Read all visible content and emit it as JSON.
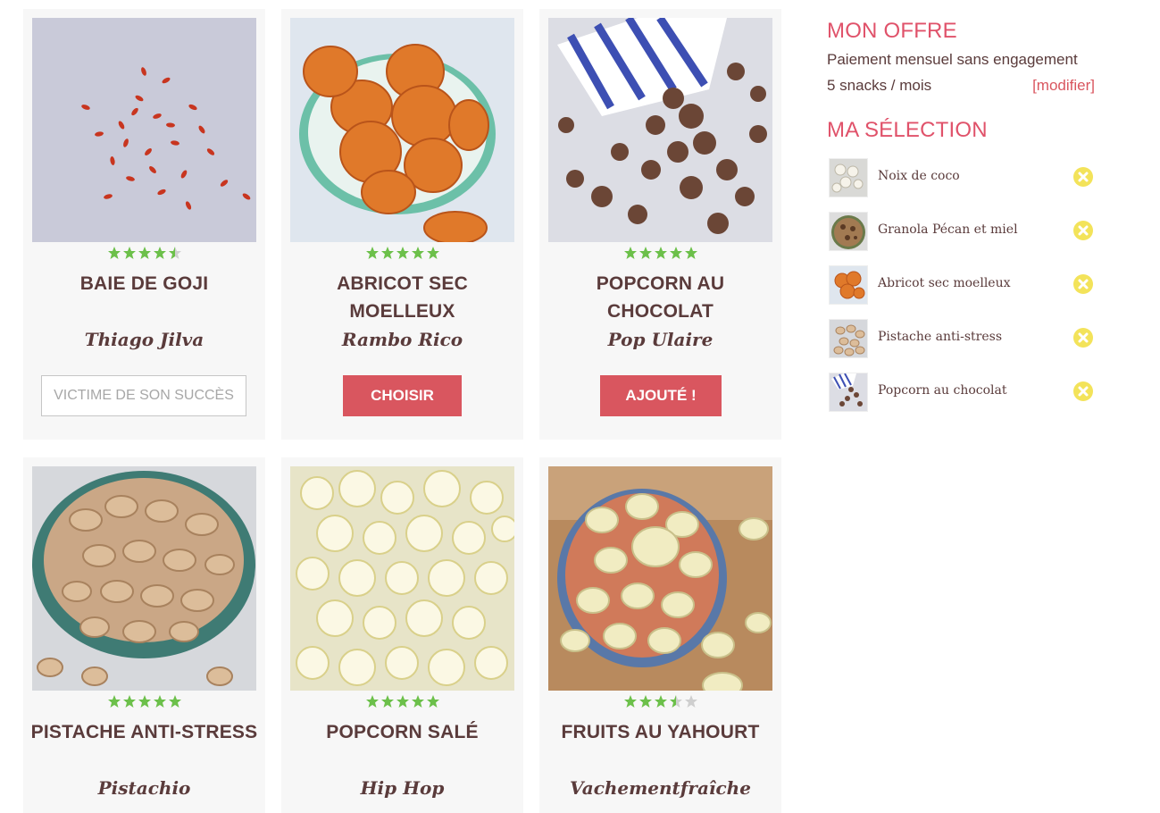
{
  "products": [
    {
      "name": "BAIE DE GOJI",
      "brand": "Thiago Jilva",
      "rating": 4.5,
      "button": "VICTIME DE SON SUCCÈS",
      "button_style": "outline",
      "image_icon": "goji-berries-image"
    },
    {
      "name": "ABRICOT SEC MOELLEUX",
      "brand": "Rambo Rico",
      "rating": 5,
      "button": "CHOISIR",
      "button_style": "red",
      "image_icon": "dried-apricot-image"
    },
    {
      "name": "POPCORN AU CHOCOLAT",
      "brand": "Pop Ulaire",
      "rating": 5,
      "button": "AJOUTÉ !",
      "button_style": "red",
      "image_icon": "chocolate-popcorn-image"
    },
    {
      "name": "PISTACHE ANTI-STRESS",
      "brand": "Pistachio",
      "rating": 5,
      "button": "",
      "button_style": "none",
      "image_icon": "pistachio-image"
    },
    {
      "name": "POPCORN SALÉ",
      "brand": "Hip Hop",
      "rating": 5,
      "button": "",
      "button_style": "none",
      "image_icon": "salted-popcorn-image"
    },
    {
      "name": "FRUITS AU YAHOURT",
      "brand": "Vachementfraîche",
      "rating": 3.5,
      "button": "",
      "button_style": "none",
      "image_icon": "yogurt-fruits-image"
    }
  ],
  "offer": {
    "title": "MON OFFRE",
    "payment": "Paiement mensuel sans engagement",
    "quantity": "5 snacks / mois",
    "modify": "[modifier]"
  },
  "selection": {
    "title": "MA SÉLECTION",
    "items": [
      {
        "label": "Noix de coco",
        "thumb": "coconut"
      },
      {
        "label": "Granola Pécan et miel",
        "thumb": "granola"
      },
      {
        "label": "Abricot sec moelleux",
        "thumb": "apricot"
      },
      {
        "label": "Pistache anti-stress",
        "thumb": "pistachio"
      },
      {
        "label": "Popcorn au chocolat",
        "thumb": "chocpop"
      }
    ]
  },
  "colors": {
    "accent": "#e0526a",
    "button": "#d9565f",
    "star": "#6cc04a",
    "star_empty": "#cfcfcf",
    "remove": "#f3e35a",
    "text": "#5a3b3b"
  }
}
